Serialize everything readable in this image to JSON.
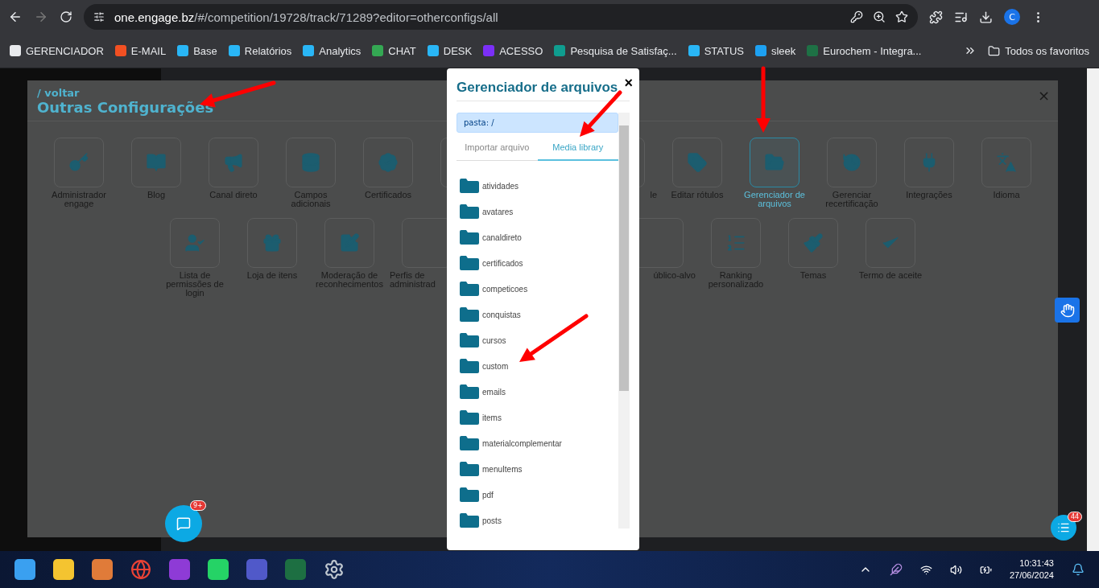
{
  "browser": {
    "url_host": "one.engage.bz",
    "url_path": "/#/competition/19728/track/71289?editor=otherconfigs/all",
    "profile": "C",
    "bookmarks": [
      {
        "label": "GERENCIADOR",
        "color": "#e8eaed"
      },
      {
        "label": "E-MAIL",
        "color": "#f25022"
      },
      {
        "label": "Base",
        "color": "#29b6f6"
      },
      {
        "label": "Relatórios",
        "color": "#29b6f6"
      },
      {
        "label": "Analytics",
        "color": "#29b6f6"
      },
      {
        "label": "CHAT",
        "color": "#34a853"
      },
      {
        "label": "DESK",
        "color": "#29b6f6"
      },
      {
        "label": "ACESSO",
        "color": "#7b2ff7"
      },
      {
        "label": "Pesquisa de Satisfaç...",
        "color": "#0f9d8f"
      },
      {
        "label": "STATUS",
        "color": "#29b6f6"
      },
      {
        "label": "sleek",
        "color": "#1da1f2"
      },
      {
        "label": "Eurochem - Integra...",
        "color": "#1e7145"
      }
    ],
    "all_bookmarks": "Todos os favoritos"
  },
  "panel": {
    "back_link": "/ voltar",
    "title": "Outras Configurações",
    "close": "×",
    "rows": [
      [
        {
          "kind": "full",
          "label": "Administrador engage",
          "selected": false
        },
        {
          "kind": "full",
          "label": "Blog",
          "selected": false
        },
        {
          "kind": "full",
          "label": "Canal direto",
          "selected": false
        },
        {
          "kind": "full",
          "label": "Campos adicionais",
          "selected": false
        },
        {
          "kind": "full",
          "label": "Certificados",
          "selected": false
        },
        {
          "kind": "cut_right",
          "selected": false
        },
        {
          "kind": "gap"
        },
        {
          "kind": "cut_left",
          "label": "le",
          "selected": false
        },
        {
          "kind": "full",
          "label": "Editar rótulos",
          "selected": false
        },
        {
          "kind": "full",
          "label": "Gerenciador de arquivos",
          "selected": true
        },
        {
          "kind": "full",
          "label": "Gerenciar recertificação",
          "selected": false
        },
        {
          "kind": "full",
          "label": "Integrações",
          "selected": false
        },
        {
          "kind": "full",
          "label": "Idioma",
          "selected": false
        }
      ],
      [
        {
          "kind": "full",
          "label": "Lista de permissões de login",
          "selected": false
        },
        {
          "kind": "full",
          "label": "Loja de itens",
          "selected": false
        },
        {
          "kind": "full",
          "label": "Moderação de reconhecimentos",
          "selected": false
        },
        {
          "kind": "cut_right",
          "label": "Perfis de administrad",
          "selected": false
        },
        {
          "kind": "gap"
        },
        {
          "kind": "gap"
        },
        {
          "kind": "cut_left",
          "label": "úblico-alvo",
          "selected": false
        },
        {
          "kind": "full",
          "label": "Ranking personalizado",
          "selected": false
        },
        {
          "kind": "full",
          "label": "Temas",
          "selected": false
        },
        {
          "kind": "full",
          "label": "Termo de aceite",
          "selected": false
        }
      ]
    ]
  },
  "modal": {
    "title": "Gerenciador de arquivos",
    "close": "×",
    "folder_path": "pasta: /",
    "tabs": [
      {
        "label": "Importar arquivo",
        "selected": false
      },
      {
        "label": "Media library",
        "selected": true
      }
    ],
    "folders": [
      "atividades",
      "avatares",
      "canaldireto",
      "certificados",
      "competicoes",
      "conquistas",
      "cursos",
      "custom",
      "emails",
      "items",
      "materialcomplementar",
      "menuItems",
      "pdf",
      "posts"
    ]
  },
  "chat_badge": "9+",
  "support_badge": "44",
  "taskbar": {
    "time": "10:31:43",
    "date": "27/06/2024"
  }
}
